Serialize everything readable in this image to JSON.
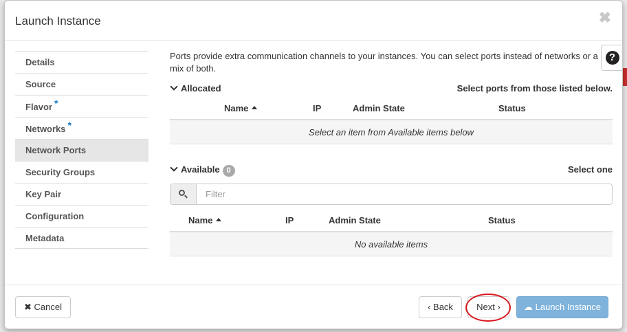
{
  "modal": {
    "title": "Launch Instance",
    "close_symbol": "✖"
  },
  "sidebar": {
    "items": [
      {
        "label": "Details",
        "required": false,
        "active": false
      },
      {
        "label": "Source",
        "required": false,
        "active": false
      },
      {
        "label": "Flavor",
        "required": true,
        "active": false
      },
      {
        "label": "Networks",
        "required": true,
        "active": false
      },
      {
        "label": "Network Ports",
        "required": false,
        "active": true
      },
      {
        "label": "Security Groups",
        "required": false,
        "active": false
      },
      {
        "label": "Key Pair",
        "required": false,
        "active": false
      },
      {
        "label": "Configuration",
        "required": false,
        "active": false
      },
      {
        "label": "Metadata",
        "required": false,
        "active": false
      }
    ],
    "required_marker": "*"
  },
  "help": {
    "symbol": "?"
  },
  "content": {
    "description": "Ports provide extra communication channels to your instances. You can select ports instead of networks or a mix of both.",
    "allocated": {
      "title": "Allocated",
      "hint": "Select ports from those listed below.",
      "columns": [
        "Name",
        "IP",
        "Admin State",
        "Status"
      ],
      "empty_text": "Select an item from Available items below"
    },
    "available": {
      "title": "Available",
      "count": "0",
      "hint": "Select one",
      "filter_placeholder": "Filter",
      "filter_value": "",
      "columns": [
        "Name",
        "IP",
        "Admin State",
        "Status"
      ],
      "empty_text": "No available items"
    }
  },
  "footer": {
    "cancel_label": "✖ Cancel",
    "back_label": "‹ Back",
    "next_label": "Next ›",
    "launch_label": "Launch Instance"
  },
  "colors": {
    "primary_disabled": "#7fb3dc",
    "required_star": "#1e7fc3",
    "highlight_ring": "#d8181f"
  }
}
